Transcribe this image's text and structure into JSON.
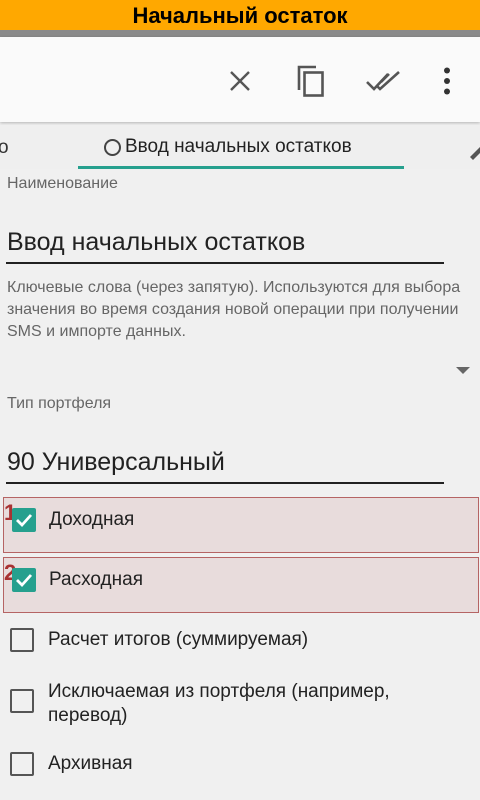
{
  "window": {
    "title": "Начальный остаток"
  },
  "toolbar": {
    "icons": [
      "close-icon",
      "copy-icon",
      "done-all-icon",
      "more-vert-icon"
    ]
  },
  "tabs": {
    "left_fragment": "о",
    "active_label": "Ввод начальных остатков"
  },
  "form": {
    "name_caption": "Наименование",
    "name_value": "Ввод начальных остатков",
    "keywords_hint": "Ключевые слова (через запятую). Используются для выбора значения во время создания новой операции при получении SMS и импорте данных.",
    "portfolio_caption": "Тип портфеля",
    "portfolio_value": "90 Универсальный"
  },
  "checkboxes": [
    {
      "label": "Доходная",
      "checked": true,
      "marker": "1"
    },
    {
      "label": "Расходная",
      "checked": true,
      "marker": "2"
    },
    {
      "label": "Расчет итогов (суммируемая)",
      "checked": false
    },
    {
      "label": "Исключаемая из портфеля (например, перевод)",
      "checked": false
    },
    {
      "label": "Архивная",
      "checked": false
    }
  ],
  "colors": {
    "title_bar": "#ffa800",
    "accent": "#26a08e",
    "highlight_bg": "#e8dcdc",
    "highlight_border": "#b56464",
    "marker": "#a83232"
  }
}
